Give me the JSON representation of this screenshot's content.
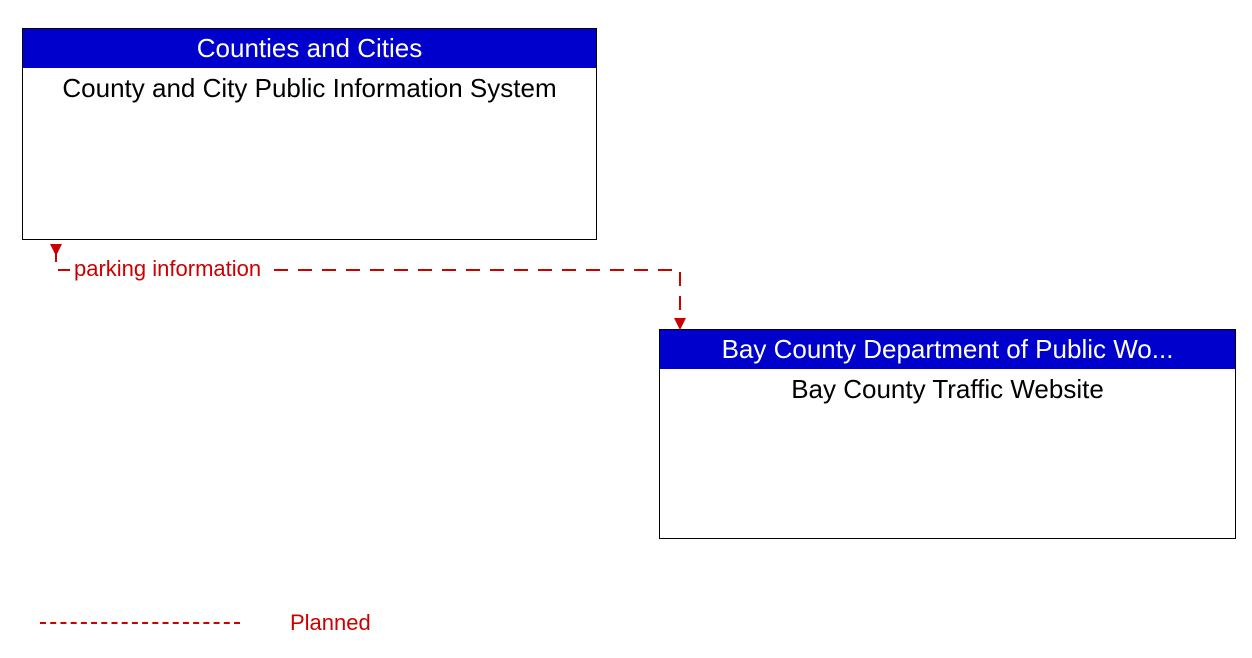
{
  "entities": {
    "top": {
      "header": "Counties and Cities",
      "body": "County and City Public Information System"
    },
    "bottom": {
      "header": "Bay County Department of Public Wo...",
      "body": "Bay County Traffic Website"
    }
  },
  "flow": {
    "label": "parking information"
  },
  "legend": {
    "planned": "Planned"
  },
  "layout": {
    "colors": {
      "header_bg": "#0000cc",
      "header_fg": "#ffffff",
      "flow_color": "#cc0000"
    }
  }
}
